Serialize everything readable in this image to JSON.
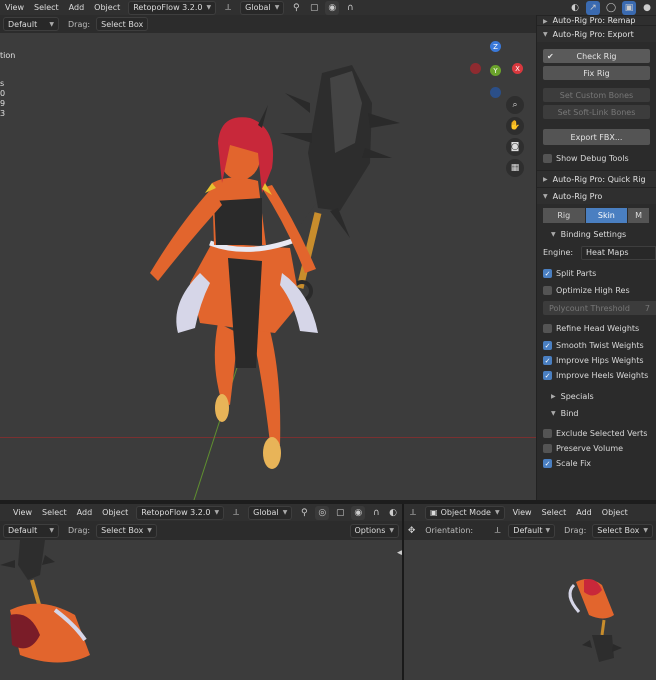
{
  "top_header": {
    "menus": [
      "View",
      "Select",
      "Add",
      "Object"
    ],
    "addon": "RetopoFlow 3.2.0",
    "orientation": "Global"
  },
  "tool_header": {
    "orientation_value": "Default",
    "drag_label": "Drag:",
    "drag_value": "Select Box"
  },
  "left_edge_text": [
    "tion",
    "s",
    "0",
    "9",
    "3"
  ],
  "panel": {
    "remap_header": "Auto-Rig Pro: Remap",
    "export_header": "Auto-Rig Pro: Export",
    "check_rig": "Check Rig",
    "fix_rig": "Fix Rig",
    "set_custom_bones": "Set Custom Bones",
    "set_softlink_bones": "Set Soft-Link Bones",
    "export_fbx": "Export FBX...",
    "show_debug": "Show Debug Tools",
    "quick_rig_header": "Auto-Rig Pro: Quick Rig",
    "arp_header": "Auto-Rig Pro",
    "tab_rig": "Rig",
    "tab_skin": "Skin",
    "tab_m": "M",
    "binding_settings": "Binding Settings",
    "engine_label": "Engine:",
    "engine_value": "Heat Maps",
    "split_parts": "Split Parts",
    "optimize_high_res": "Optimize High Res",
    "polycount_threshold": "Polycount Threshold",
    "polycount_value": "7",
    "refine_head": "Refine Head Weights",
    "smooth_twist": "Smooth Twist Weights",
    "improve_hips": "Improve Hips Weights",
    "improve_heels": "Improve Heels Weights",
    "specials": "Specials",
    "bind": "Bind",
    "exclude_selected": "Exclude Selected Verts",
    "preserve_volume": "Preserve Volume",
    "scale_fix": "Scale Fix"
  },
  "bottom_left": {
    "menus": [
      "View",
      "Select",
      "Add",
      "Object"
    ],
    "addon": "RetopoFlow 3.2.0",
    "orientation": "Global",
    "tool_orientation": "Default",
    "drag_label": "Drag:",
    "drag_value": "Select Box",
    "options": "Options"
  },
  "bottom_right": {
    "mode": "Object Mode",
    "menus": [
      "View",
      "Select",
      "Add",
      "Object"
    ],
    "orientation_label": "Orientation:",
    "orientation_value": "Default",
    "drag_label": "Drag:",
    "drag_value": "Select Box"
  },
  "gizmo": {
    "z": "Z",
    "y": "Y",
    "x": "X"
  },
  "colors": {
    "accent": "#4a7fc1",
    "axis_x": "#d9383e",
    "axis_y": "#6ba32b",
    "axis_z": "#3a79d9",
    "skin": "#e2652d",
    "hair": "#c8283a"
  }
}
